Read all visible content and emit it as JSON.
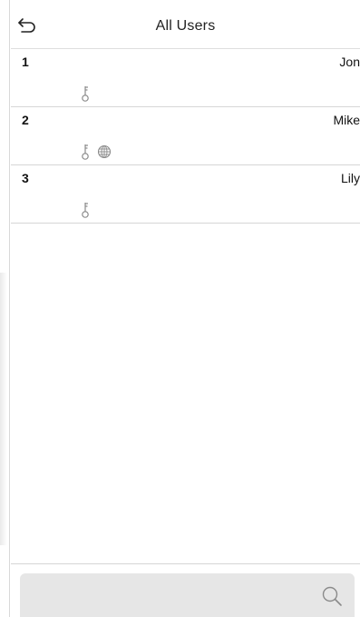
{
  "header": {
    "title": "All Users",
    "back_icon": "back-arrow-icon"
  },
  "users": [
    {
      "id": "1",
      "name": "Jon",
      "verify_icons": [
        "password-key-icon"
      ]
    },
    {
      "id": "2",
      "name": "Mike",
      "verify_icons": [
        "password-key-icon",
        "face-icon"
      ]
    },
    {
      "id": "3",
      "name": "Lily",
      "verify_icons": [
        "password-key-icon"
      ]
    }
  ],
  "search": {
    "icon": "search-icon"
  },
  "colors": {
    "background": "#ffffff",
    "divider": "#d6d6d6",
    "search_bar": "#e6e6e6",
    "icon_gray": "#8a8a8a"
  }
}
